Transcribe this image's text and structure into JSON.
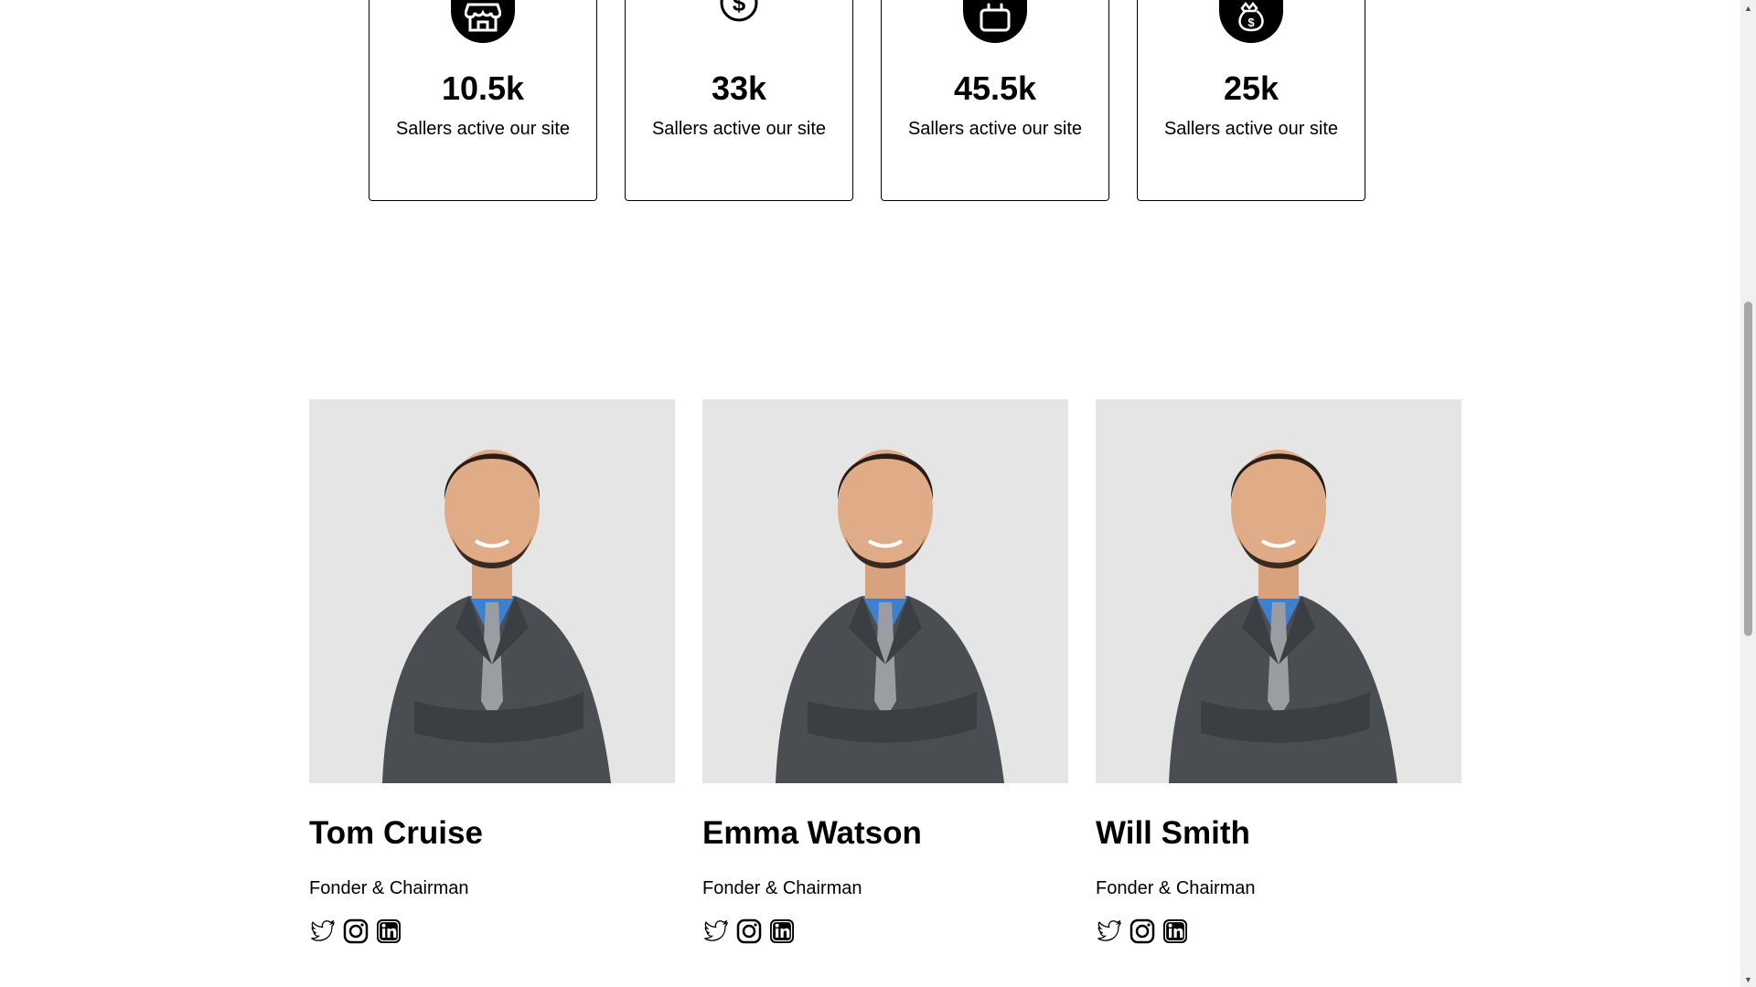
{
  "stats": [
    {
      "icon": "store-icon",
      "value": "10.5k",
      "label": "Sallers active our site"
    },
    {
      "icon": "dollar-icon",
      "value": "33k",
      "label": "Sallers active our site"
    },
    {
      "icon": "shopping-bag-icon",
      "value": "45.5k",
      "label": "Sallers active our site"
    },
    {
      "icon": "money-bag-icon",
      "value": "25k",
      "label": "Sallers active our site"
    }
  ],
  "team": [
    {
      "name": "Tom Cruise",
      "role": "Fonder & Chairman",
      "socials": [
        "twitter-icon",
        "instagram-icon",
        "linkedin-icon"
      ]
    },
    {
      "name": "Emma Watson",
      "role": "Fonder & Chairman",
      "socials": [
        "twitter-icon",
        "instagram-icon",
        "linkedin-icon"
      ]
    },
    {
      "name": "Will Smith",
      "role": "Fonder & Chairman",
      "socials": [
        "twitter-icon",
        "instagram-icon",
        "linkedin-icon"
      ]
    }
  ],
  "colors": {
    "photo_background": "#e5e5e5",
    "suit": "#4a4d52",
    "shirt": "#3f7fcf",
    "tie": "#9a9ea3"
  }
}
